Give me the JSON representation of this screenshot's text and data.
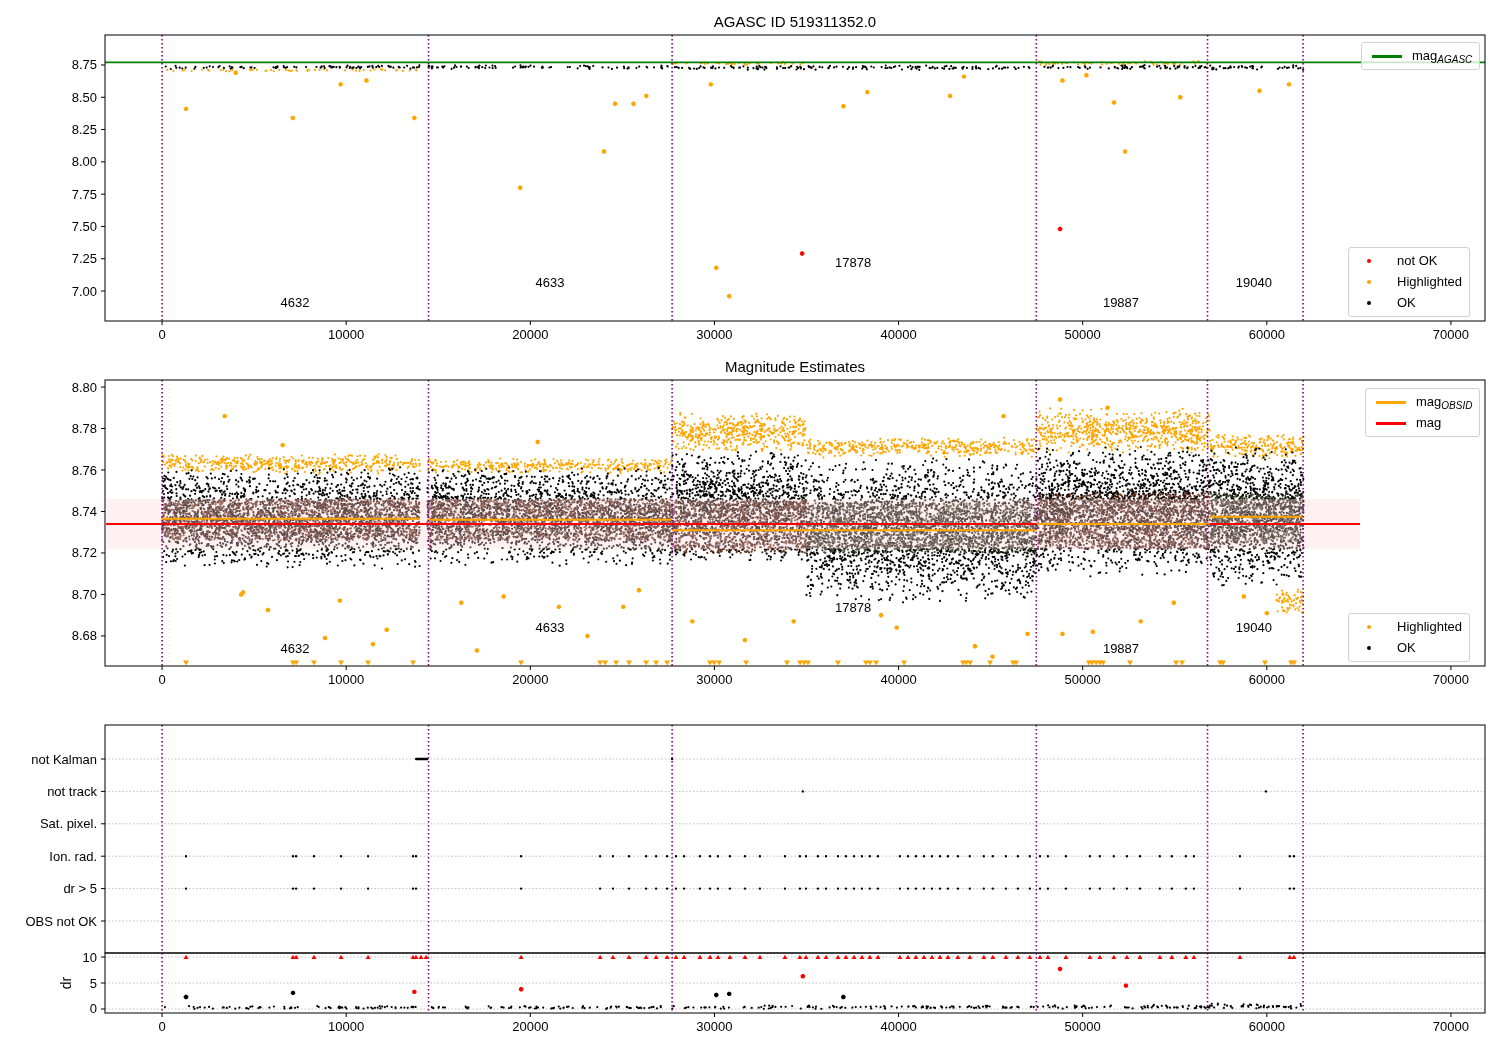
{
  "figure": {
    "panels": [
      {
        "chart_data": {
          "type": "scatter",
          "title": "AGASC ID 519311352.0",
          "xlim": [
            -3100,
            71850
          ],
          "ylim": [
            6.768,
            8.982
          ],
          "xticks": [
            0,
            10000,
            20000,
            30000,
            40000,
            50000,
            60000,
            70000
          ],
          "yticks": [
            {
              "value": 7,
              "label": "7.00"
            },
            {
              "value": 7.25,
              "label": "7.25"
            },
            {
              "value": 7.5,
              "label": "7.50"
            },
            {
              "value": 7.75,
              "label": "7.75"
            },
            {
              "value": 8,
              "label": "8.00"
            },
            {
              "value": 8.25,
              "label": "8.25"
            },
            {
              "value": 8.5,
              "label": "8.50"
            },
            {
              "value": 8.75,
              "label": "8.75"
            }
          ],
          "series": [
            {
              "color": "#ff0000",
              "x": [
                34760,
                48770
              ],
              "values": [
                7.29,
                7.48
              ]
            },
            {
              "color": "#ffa500",
              "x": [
                1300,
                7100,
                13700,
                19450,
                24000,
                30100,
                30800,
                37000,
                24600,
                25600,
                26300,
                29800,
                42800,
                51700,
                52300,
                55300,
                59600,
                9700,
                11100,
                38300,
                43550,
                48900,
                50200,
                4000,
                61200
              ],
              "values": [
                8.41,
                8.34,
                8.34,
                7.8,
                8.08,
                7.18,
                6.96,
                8.43,
                8.45,
                8.45,
                8.51,
                8.6,
                8.51,
                8.46,
                8.08,
                8.5,
                8.55,
                8.6,
                8.63,
                8.54,
                8.66,
                8.63,
                8.67,
                8.69,
                8.6
              ]
            }
          ],
          "ref_lines": [
            {
              "axis": "y",
              "value": 8.77,
              "color": "#008000"
            },
            {
              "axis": "x",
              "value": 0,
              "color": "#800080"
            },
            {
              "axis": "x",
              "value": 14470,
              "color": "#800080"
            },
            {
              "axis": "x",
              "value": 27700,
              "color": "#800080"
            },
            {
              "axis": "x",
              "value": 47480,
              "color": "#800080"
            },
            {
              "axis": "x",
              "value": 56780,
              "color": "#800080"
            },
            {
              "axis": "x",
              "value": 61970,
              "color": "#800080"
            }
          ],
          "annotations": [
            "4632",
            "4633",
            "17878",
            "19887",
            "19040"
          ]
        },
        "legend": [
          [
            {
              "label": "mag$_{AGASC}$",
              "color": "#008000",
              "kind": "line"
            }
          ],
          [
            {
              "label": "not OK",
              "color": "#ff0000",
              "kind": "dot"
            },
            {
              "label": "Highlighted",
              "color": "#ffa500",
              "kind": "dot"
            },
            {
              "label": "OK",
              "color": "#000000",
              "kind": "dot"
            }
          ]
        ]
      },
      {
        "chart_data": {
          "type": "scatter",
          "title": "Magnitude Estimates",
          "xlim": [
            -3100,
            71850
          ],
          "ylim": [
            8.6655,
            8.8034
          ],
          "xticks": [
            0,
            10000,
            20000,
            30000,
            40000,
            50000,
            60000,
            70000
          ],
          "yticks": [
            {
              "value": 8.68,
              "label": "8.68"
            },
            {
              "value": 8.7,
              "label": "8.70"
            },
            {
              "value": 8.72,
              "label": "8.72"
            },
            {
              "value": 8.74,
              "label": "8.74"
            },
            {
              "value": 8.76,
              "label": "8.76"
            },
            {
              "value": 8.78,
              "label": "8.78"
            },
            {
              "value": 8.8,
              "label": "8.80"
            }
          ],
          "series": [
            {
              "type": "line",
              "color": "#ff0000",
              "x": [
                -3040,
                65060
              ],
              "values": [
                8.734,
                8.734
              ]
            },
            {
              "type": "line",
              "color": "#ffa500",
              "x": [
                0,
                14000
              ],
              "values": [
                8.7365,
                8.7365
              ]
            },
            {
              "type": "line",
              "color": "#ffa500",
              "x": [
                14400,
                27700
              ],
              "values": [
                8.736,
                8.736
              ]
            },
            {
              "type": "line",
              "color": "#ffa500",
              "x": [
                27700,
                47500
              ],
              "values": [
                8.731,
                8.731
              ]
            },
            {
              "type": "line",
              "color": "#ffa500",
              "x": [
                47500,
                56900
              ],
              "values": [
                8.734,
                8.734
              ]
            },
            {
              "type": "line",
              "color": "#ffa500",
              "x": [
                56900,
                62000
              ],
              "values": [
                8.7375,
                8.7375
              ]
            },
            {
              "color": "#ffa500",
              "x": [
                4400,
                4300,
                5750,
                9650,
                8850,
                12200,
                11450,
                17100,
                16250,
                18550,
                21550,
                23100,
                25050,
                25900,
                28800,
                31650,
                34300,
                39050,
                39900,
                44150,
                45100,
                47000,
                48900,
                50550,
                53150,
                54950,
                58750,
                60000,
                45700,
                48770,
                51350,
                3400,
                6550,
                20400
              ],
              "values": [
                8.701,
                8.7,
                8.6925,
                8.697,
                8.679,
                8.683,
                8.676,
                8.673,
                8.696,
                8.699,
                8.694,
                8.68,
                8.694,
                8.702,
                8.687,
                8.678,
                8.687,
                8.69,
                8.684,
                8.675,
                8.67,
                8.681,
                8.681,
                8.682,
                8.687,
                8.696,
                8.699,
                8.691,
                8.786,
                8.794,
                8.79,
                8.786,
                8.772,
                8.7735
              ]
            },
            {
              "marker": "triangle_down",
              "color": "#ffa500",
              "x": [
                1300,
                7110,
                7280,
                8250,
                9720,
                11190,
                13630,
                19500,
                23790,
                24060,
                24660,
                25360,
                26290,
                26830,
                27430,
                29760,
                29980,
                30250,
                31720,
                33940,
                34650,
                34870,
                35080,
                36710,
                38230,
                38450,
                38780,
                40300,
                43500,
                43670,
                43880,
                44970,
                46220,
                46380,
                50340,
                50510,
                50730,
                50940,
                51110,
                52570,
                55070,
                55400,
                57460,
                57620,
                59900,
                61320,
                61480
              ],
              "values": [
                8.667,
                8.667,
                8.667,
                8.667,
                8.667,
                8.667,
                8.667,
                8.667,
                8.667,
                8.667,
                8.667,
                8.667,
                8.667,
                8.667,
                8.667,
                8.667,
                8.667,
                8.667,
                8.667,
                8.667,
                8.667,
                8.667,
                8.667,
                8.667,
                8.667,
                8.667,
                8.667,
                8.667,
                8.667,
                8.667,
                8.667,
                8.667,
                8.667,
                8.667,
                8.667,
                8.667,
                8.667,
                8.667,
                8.667,
                8.667,
                8.667,
                8.667,
                8.667,
                8.667,
                8.667,
                8.667,
                8.667
              ]
            }
          ],
          "bands": [
            {
              "axis": "y",
              "from": 8.722,
              "to": 8.746,
              "color": "#ffd6d9"
            }
          ],
          "ref_lines": [
            {
              "axis": "x",
              "value": 0,
              "color": "#800080"
            },
            {
              "axis": "x",
              "value": 14470,
              "color": "#800080"
            },
            {
              "axis": "x",
              "value": 27700,
              "color": "#800080"
            },
            {
              "axis": "x",
              "value": 47480,
              "color": "#800080"
            },
            {
              "axis": "x",
              "value": 56780,
              "color": "#800080"
            },
            {
              "axis": "x",
              "value": 61970,
              "color": "#800080"
            }
          ],
          "annotations": [
            "4632",
            "4633",
            "17878",
            "19887",
            "19040"
          ]
        },
        "legend": [
          [
            {
              "label": "mag$_{OBSID}$",
              "color": "#ffa500",
              "kind": "line"
            },
            {
              "label": "mag",
              "color": "#ff0000",
              "kind": "line"
            }
          ],
          [
            {
              "label": "Highlighted",
              "color": "#ffa500",
              "kind": "dot"
            },
            {
              "label": "OK",
              "color": "#000000",
              "kind": "dot"
            }
          ]
        ]
      },
      {
        "flag_rows": [
          "not Kalman",
          "not track",
          "Sat. pixel.",
          "Ion. rad.",
          "dr > 5",
          "OBS not OK"
        ]
      },
      {
        "chart_data": {
          "type": "scatter",
          "grid": true,
          "ylabel": "dr",
          "xlim": [
            -3100,
            71850
          ],
          "ylim": [
            -0.77,
            10.77
          ],
          "xticks": [
            0,
            10000,
            20000,
            30000,
            40000,
            50000,
            60000,
            70000
          ],
          "yticks": [
            0,
            5,
            10
          ],
          "series": [
            {
              "marker": "triangle",
              "color": "#ff0000",
              "x": [
                1300,
                7110,
                7280,
                8250,
                9720,
                11190,
                13630,
                13790,
                19500,
                23790,
                24490,
                25360,
                26290,
                26830,
                27430,
                27910,
                28350,
                29210,
                29760,
                30190,
                30840,
                31660,
                32470,
                33830,
                34640,
                34970,
                35620,
                36060,
                36710,
                37140,
                37580,
                38010,
                38440,
                38880,
                40070,
                40510,
                40940,
                41380,
                41810,
                42250,
                42680,
                43220,
                43870,
                44630,
                45120,
                45830,
                46480,
                47130,
                47680,
                48110,
                49090,
                50390,
                50930,
                51690,
                52400,
                53110,
                54190,
                54840,
                55600,
                56040,
                58540,
                61250,
                61470,
                14060,
                14340
              ],
              "values": [
                10,
                10,
                10,
                10,
                10,
                10,
                10,
                10,
                10,
                10,
                10,
                10,
                10,
                10,
                10,
                10,
                10,
                10,
                10,
                10,
                10,
                10,
                10,
                10,
                10,
                10,
                10,
                10,
                10,
                10,
                10,
                10,
                10,
                10,
                10,
                10,
                10,
                10,
                10,
                10,
                10,
                10,
                10,
                10,
                10,
                10,
                10,
                10,
                10,
                10,
                10,
                10,
                10,
                10,
                10,
                10,
                10,
                10,
                10,
                10,
                10,
                10,
                10,
                10,
                10
              ]
            },
            {
              "color": "#ff0000",
              "x": [
                34800,
                48770,
                52350,
                19500,
                13700
              ],
              "values": [
                6.3,
                7.7,
                4.5,
                3.8,
                3.3
              ]
            },
            {
              "color": "#000000",
              "x": [
                1300,
                7110,
                30100,
                30800,
                37000
              ],
              "values": [
                2.3,
                3.1,
                2.7,
                2.9,
                2.3
              ]
            }
          ],
          "ref_lines": [
            {
              "axis": "x",
              "value": 0,
              "color": "#800080"
            },
            {
              "axis": "x",
              "value": 14470,
              "color": "#800080"
            },
            {
              "axis": "x",
              "value": 27700,
              "color": "#800080"
            },
            {
              "axis": "x",
              "value": 47480,
              "color": "#800080"
            },
            {
              "axis": "x",
              "value": 56780,
              "color": "#800080"
            },
            {
              "axis": "x",
              "value": 61970,
              "color": "#800080"
            }
          ]
        }
      }
    ]
  }
}
